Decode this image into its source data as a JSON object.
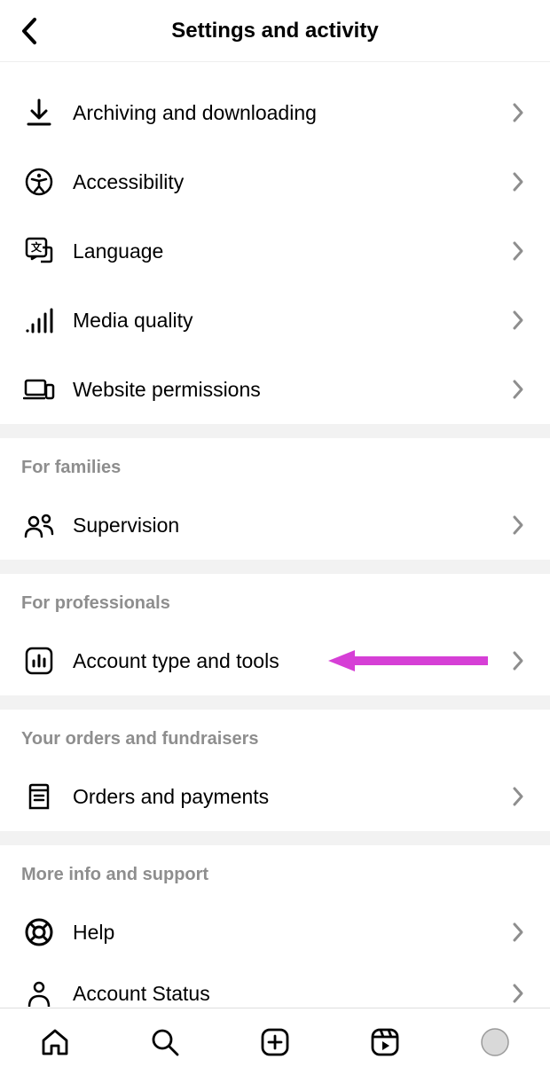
{
  "header": {
    "title": "Settings and activity"
  },
  "sections": {
    "top": {
      "archiving": "Archiving and downloading",
      "accessibility": "Accessibility",
      "language": "Language",
      "media_quality": "Media quality",
      "website_permissions": "Website permissions"
    },
    "families": {
      "title": "For families",
      "supervision": "Supervision"
    },
    "professionals": {
      "title": "For professionals",
      "account_type": "Account type and tools"
    },
    "orders": {
      "title": "Your orders and fundraisers",
      "orders_payments": "Orders and payments"
    },
    "support": {
      "title": "More info and support",
      "help": "Help",
      "account_status": "Account Status"
    }
  },
  "annotation": {
    "arrow_color": "#d63fd6"
  }
}
